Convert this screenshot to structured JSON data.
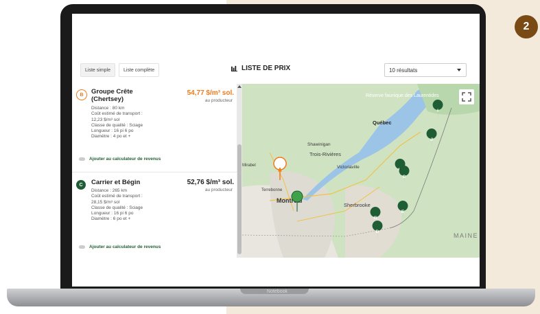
{
  "step_badge": "2",
  "laptop_brand": "Notebook",
  "toolbar": {
    "tab_simple": "Liste simple",
    "tab_complete": "Liste complète",
    "title": "LISTE DE PRIX",
    "results_select": "10 résultats"
  },
  "results": [
    {
      "marker": "B",
      "name": "Groupe Crête (Chertsey)",
      "price": "54,77 $/m³ sol.",
      "price_sub": "au producteur",
      "details": [
        "Distance : 80 km",
        "Coût estimé de transport :",
        "12,23 $/m³ sol",
        "Classe de qualité : Sciage",
        "Longueur : 16 pi 6 po",
        "Diamètre : 4 po et +"
      ],
      "add_label": "Ajouter au calculateur de revenus",
      "price_color": "#f07a1a"
    },
    {
      "marker": "C",
      "name": "Carrier et Bégin",
      "price": "52,76 $/m³ sol.",
      "price_sub": "au producteur",
      "details": [
        "Distance : 265 km",
        "Coût estimé de transport :",
        "28,15 $/m³ sol",
        "Classe de qualité : Sciage",
        "Longueur : 16 pi 6 po",
        "Diamètre : 6 po et +"
      ],
      "add_label": "Ajouter au calculateur de revenus",
      "price_color": "#222222"
    }
  ],
  "map": {
    "labels": {
      "reserve": "Réserve faunique des Laurentides",
      "quebec": "Québec",
      "shawinigan": "Shawinigan",
      "trois_rivieres": "Trois-Rivières",
      "victoriaville": "Victoriaville",
      "mirabel": "Mirabel",
      "terrebonne": "Terrebonne",
      "montreal": "Montréal",
      "sherbrooke": "Sherbrooke",
      "maine": "MAINE"
    },
    "markers": [
      "A",
      "B",
      "C",
      "D",
      "E",
      "G",
      "H",
      "I",
      "J"
    ],
    "colors": {
      "dark_marker": "#1f5d34",
      "orange_marker": "#f07a1a",
      "selected_marker": "#3fa24a"
    }
  }
}
